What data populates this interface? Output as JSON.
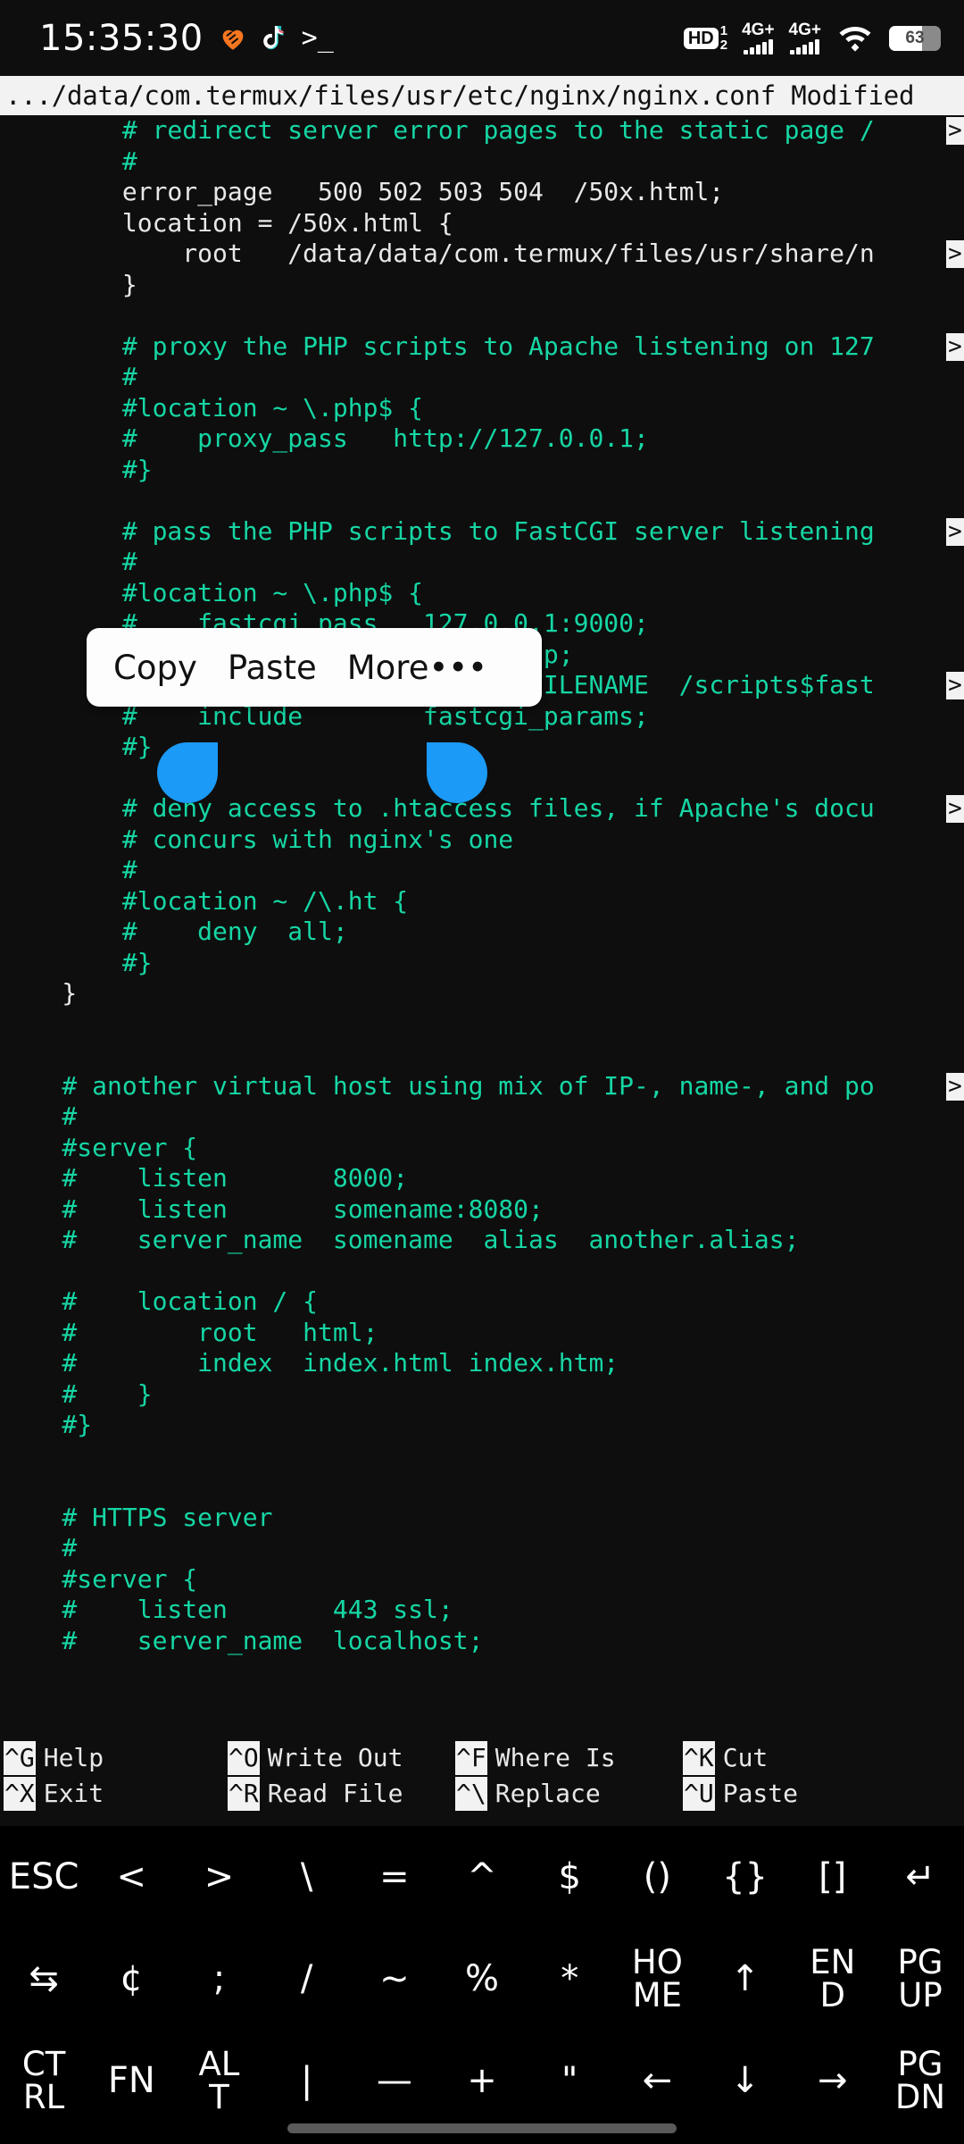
{
  "statusbar": {
    "time": "15:35:30",
    "left_icons": [
      {
        "name": "heart-icon",
        "glyph": "heart"
      },
      {
        "name": "tiktok-icon",
        "glyph": "tiktok"
      },
      {
        "name": "terminal-prompt-icon",
        "glyph": ">_"
      }
    ],
    "hd_badge": {
      "label": "HD",
      "sup": "1",
      "sub": "2"
    },
    "signal_1": {
      "label": "4G+",
      "bars": 4
    },
    "signal_2": {
      "label": "4G+",
      "bars": 4
    },
    "wifi": {
      "name": "wifi-icon"
    },
    "battery": {
      "percent": "63",
      "level": 63
    }
  },
  "titlebar": {
    "text": ".../data/com.termux/files/usr/etc/nginx/nginx.conf Modified",
    "path": ".../data/com.termux/files/usr/etc/nginx/nginx.conf",
    "status": "Modified"
  },
  "editor": {
    "continuation_marker": ">",
    "lines": [
      {
        "text": "        # redirect server error pages to the static page /",
        "type": "cm",
        "cont": true
      },
      {
        "text": "        #",
        "type": "cm"
      },
      {
        "text": "        error_page   500 502 503 504  /50x.html;",
        "type": "cd"
      },
      {
        "text": "        location = /50x.html {",
        "type": "cd"
      },
      {
        "text": "            root   /data/data/com.termux/files/usr/share/n",
        "type": "cd",
        "cont": true
      },
      {
        "text": "        }",
        "type": "cd"
      },
      {
        "text": "",
        "type": "cd"
      },
      {
        "text": "        # proxy the PHP scripts to Apache listening on 127",
        "type": "cm",
        "cont": true
      },
      {
        "text": "        #",
        "type": "cm"
      },
      {
        "text": "        #location ~ \\.php$ {",
        "type": "cm"
      },
      {
        "text": "        #    proxy_pass   http://127.0.0.1;",
        "type": "cm"
      },
      {
        "text": "        #}",
        "type": "cm"
      },
      {
        "text": "",
        "type": "cd"
      },
      {
        "text": "        # pass the PHP scripts to FastCGI server listening",
        "type": "cm",
        "cont": true
      },
      {
        "text": "        #",
        "type": "cm"
      },
      {
        "text": "        #location ~ \\.php$ {",
        "type": "cm"
      },
      {
        "text": "        #    fastcgi_pass   127.0.0.1:9000;",
        "type": "cm"
      },
      {
        "text": "        #    fastcgi_index  index.php;",
        "type": "cm"
      },
      {
        "text": "        #    fastcgi_param  SCRIPT_FILENAME  /scripts$fast",
        "type": "cm",
        "cont": true
      },
      {
        "text": "        #    include        fastcgi_params;",
        "type": "cm"
      },
      {
        "text": "        #}",
        "type": "cm"
      },
      {
        "text": "",
        "type": "cd"
      },
      {
        "text": "        # deny access to .htaccess files, if Apache's docu",
        "type": "cm",
        "cont": true
      },
      {
        "text": "        # concurs with nginx's one",
        "type": "cm"
      },
      {
        "text": "        #",
        "type": "cm"
      },
      {
        "text": "        #location ~ /\\.ht {",
        "type": "cm"
      },
      {
        "text": "        #    deny  all;",
        "type": "cm"
      },
      {
        "text": "        #}",
        "type": "cm"
      },
      {
        "text": "    }",
        "type": "cd"
      },
      {
        "text": "",
        "type": "cd"
      },
      {
        "text": "",
        "type": "cd"
      },
      {
        "text": "    # another virtual host using mix of IP-, name-, and po",
        "type": "cm",
        "cont": true
      },
      {
        "text": "    #",
        "type": "cm"
      },
      {
        "text": "    #server {",
        "type": "cm"
      },
      {
        "text": "    #    listen       8000;",
        "type": "cm"
      },
      {
        "text": "    #    listen       somename:8080;",
        "type": "cm"
      },
      {
        "text": "    #    server_name  somename  alias  another.alias;",
        "type": "cm"
      },
      {
        "text": "",
        "type": "cd"
      },
      {
        "text": "    #    location / {",
        "type": "cm"
      },
      {
        "text": "    #        root   html;",
        "type": "cm"
      },
      {
        "text": "    #        index  index.html index.htm;",
        "type": "cm"
      },
      {
        "text": "    #    }",
        "type": "cm"
      },
      {
        "text": "    #}",
        "type": "cm"
      },
      {
        "text": "",
        "type": "cd"
      },
      {
        "text": "",
        "type": "cd"
      },
      {
        "text": "    # HTTPS server",
        "type": "cm"
      },
      {
        "text": "    #",
        "type": "cm"
      },
      {
        "text": "    #server {",
        "type": "cm"
      },
      {
        "text": "    #    listen       443 ssl;",
        "type": "cm"
      },
      {
        "text": "    #    server_name  localhost;",
        "type": "cm"
      }
    ],
    "selected_text": "fastcgi_param",
    "cursor_char": "i"
  },
  "selection_popup": {
    "actions": [
      {
        "name": "copy-action",
        "label": "Copy"
      },
      {
        "name": "paste-action",
        "label": "Paste"
      },
      {
        "name": "more-action",
        "label": "More•••"
      }
    ]
  },
  "shortcuts": [
    {
      "rows": [
        {
          "key": "^G",
          "label": "Help"
        },
        {
          "key": "^X",
          "label": "Exit"
        }
      ]
    },
    {
      "rows": [
        {
          "key": "^O",
          "label": "Write Out"
        },
        {
          "key": "^R",
          "label": "Read File"
        }
      ]
    },
    {
      "rows": [
        {
          "key": "^F",
          "label": "Where Is"
        },
        {
          "key": "^\\",
          "label": "Replace"
        }
      ]
    },
    {
      "rows": [
        {
          "key": "^K",
          "label": "Cut"
        },
        {
          "key": "^U",
          "label": "Paste"
        }
      ]
    }
  ],
  "extra_keys": {
    "row1": [
      {
        "name": "key-esc",
        "label": "ESC"
      },
      {
        "name": "key-less-than",
        "label": "<"
      },
      {
        "name": "key-greater-than",
        "label": ">"
      },
      {
        "name": "key-backslash",
        "label": "\\"
      },
      {
        "name": "key-equals",
        "label": "="
      },
      {
        "name": "key-caret",
        "label": "^"
      },
      {
        "name": "key-dollar",
        "label": "$"
      },
      {
        "name": "key-parens",
        "label": "()"
      },
      {
        "name": "key-braces",
        "label": "{}"
      },
      {
        "name": "key-brackets",
        "label": "[]"
      },
      {
        "name": "key-enter",
        "label": "↵"
      }
    ],
    "row2": [
      {
        "name": "key-tab",
        "label": "⇆"
      },
      {
        "name": "key-cent",
        "label": "¢"
      },
      {
        "name": "key-semicolon",
        "label": ";"
      },
      {
        "name": "key-slash",
        "label": "/"
      },
      {
        "name": "key-tilde",
        "label": "~"
      },
      {
        "name": "key-percent",
        "label": "%"
      },
      {
        "name": "key-asterisk",
        "label": "*"
      },
      {
        "name": "key-home",
        "label": "HO\nME"
      },
      {
        "name": "key-arrow-up",
        "label": "↑"
      },
      {
        "name": "key-end",
        "label": "EN\nD"
      },
      {
        "name": "key-page-up",
        "label": "PG\nUP"
      }
    ],
    "row3": [
      {
        "name": "key-ctrl",
        "label": "CT\nRL"
      },
      {
        "name": "key-fn",
        "label": "FN"
      },
      {
        "name": "key-alt",
        "label": "AL\nT"
      },
      {
        "name": "key-pipe",
        "label": "|"
      },
      {
        "name": "key-minus",
        "label": "—"
      },
      {
        "name": "key-plus",
        "label": "+"
      },
      {
        "name": "key-quote",
        "label": "\""
      },
      {
        "name": "key-arrow-left",
        "label": "←"
      },
      {
        "name": "key-arrow-down",
        "label": "↓"
      },
      {
        "name": "key-arrow-right",
        "label": "→"
      },
      {
        "name": "key-page-down",
        "label": "PG\nDN"
      }
    ]
  },
  "colors": {
    "background": "#0e0e0e",
    "comment": "#16d6a4",
    "code": "#e8e8e8",
    "titlebar_bg": "#f2f2f2",
    "selection_highlight": "#21e6a8",
    "selection_handle": "#1b9af7",
    "popup_bg": "#fdfdfd"
  }
}
